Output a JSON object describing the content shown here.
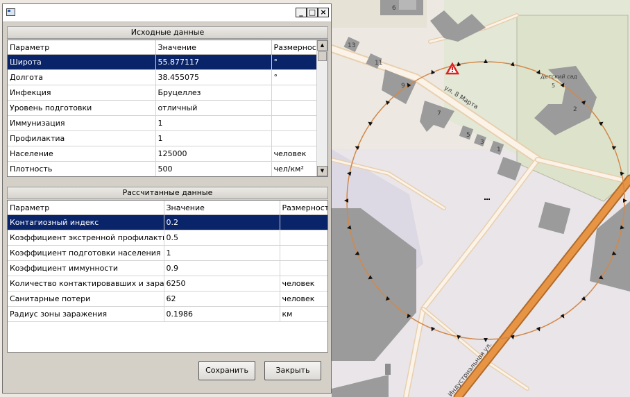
{
  "window": {
    "minimize": "_",
    "maximize": "□",
    "close": "×"
  },
  "initial": {
    "title": "Исходные данные",
    "headers": [
      "Параметр",
      "Значение",
      "Размерность"
    ],
    "rows": [
      [
        "Широта",
        "55.877117",
        "°"
      ],
      [
        "Долгота",
        "38.455075",
        "°"
      ],
      [
        "Инфекция",
        "Бруцеллез",
        ""
      ],
      [
        "Уровень подготовки",
        "отличный",
        ""
      ],
      [
        "Иммунизация",
        "1",
        ""
      ],
      [
        "Профилактиа",
        "1",
        ""
      ],
      [
        "Население",
        "125000",
        "человек"
      ],
      [
        "Плотность",
        "500",
        "чел/км²"
      ]
    ]
  },
  "computed": {
    "title": "Рассчитанные данные",
    "headers": [
      "Параметр",
      "Значение",
      "Размерность"
    ],
    "rows": [
      [
        "Контагиозный индекс",
        "0.2",
        ""
      ],
      [
        "Коэффициент экстренной профилактики",
        "0.5",
        ""
      ],
      [
        "Коэффициент подготовки населения",
        "1",
        ""
      ],
      [
        "Коэффициент иммунности",
        "0.9",
        ""
      ],
      [
        "Количество контактировавших и заражённых",
        "6250",
        "человек"
      ],
      [
        "Санитарные потери",
        "62",
        "человек"
      ],
      [
        "Радиус зоны заражения",
        "0.1986",
        "км"
      ]
    ]
  },
  "buttons": {
    "save": "Сохранить",
    "close": "Закрыть"
  },
  "map": {
    "street_label": "ул. 8 Марта",
    "street2_label": "Индустриальная ул.",
    "kindergarten_label": "Детский сад",
    "kindergarten_number": "5",
    "building_numbers": [
      "6",
      "13",
      "11",
      "9",
      "7",
      "5",
      "3",
      "1",
      "2"
    ],
    "zone_color": "#d2884a"
  }
}
